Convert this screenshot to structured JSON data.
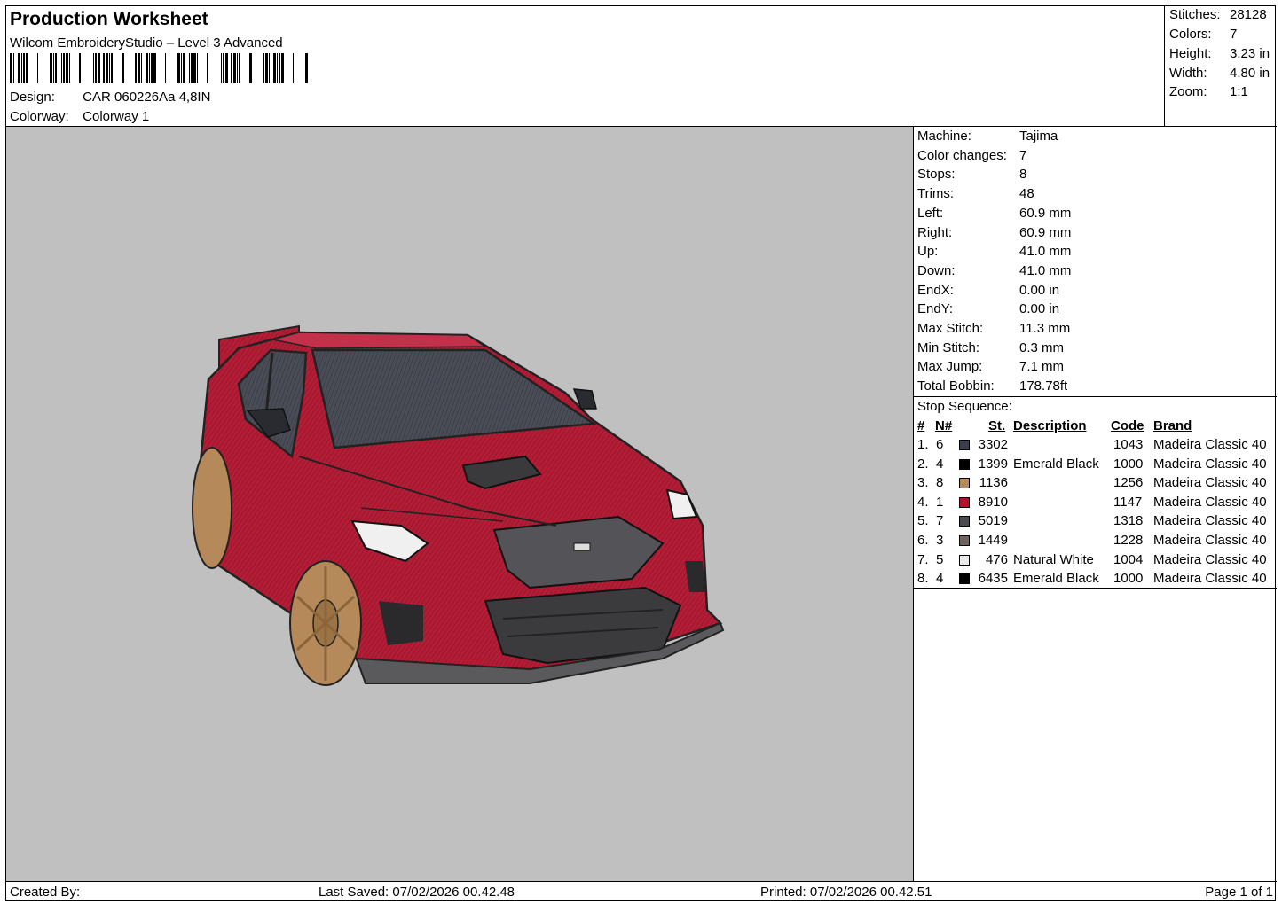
{
  "header": {
    "title": "Production Worksheet",
    "subtitle": "Wilcom EmbroideryStudio – Level 3 Advanced",
    "design_label": "Design:",
    "design_value": "CAR 060226Aa 4,8IN",
    "colorway_label": "Colorway:",
    "colorway_value": "Colorway 1"
  },
  "summary": {
    "stitches_label": "Stitches:",
    "stitches": "28128",
    "colors_label": "Colors:",
    "colors": "7",
    "height_label": "Height:",
    "height": "3.23 in",
    "width_label": "Width:",
    "width": "4.80 in",
    "zoom_label": "Zoom:",
    "zoom": "1:1"
  },
  "machine": {
    "rows": [
      {
        "k": "Machine:",
        "v": "Tajima"
      },
      {
        "k": "Color changes:",
        "v": "7"
      },
      {
        "k": "Stops:",
        "v": "8"
      },
      {
        "k": "Trims:",
        "v": "48"
      },
      {
        "k": "Left:",
        "v": "60.9 mm"
      },
      {
        "k": "Right:",
        "v": "60.9 mm"
      },
      {
        "k": "Up:",
        "v": "41.0 mm"
      },
      {
        "k": "Down:",
        "v": "41.0 mm"
      },
      {
        "k": "EndX:",
        "v": "0.00 in"
      },
      {
        "k": "EndY:",
        "v": "0.00 in"
      },
      {
        "k": "Max Stitch:",
        "v": "11.3 mm"
      },
      {
        "k": "Min Stitch:",
        "v": "0.3 mm"
      },
      {
        "k": "Max Jump:",
        "v": "7.1 mm"
      },
      {
        "k": "Total Bobbin:",
        "v": "178.78ft"
      }
    ]
  },
  "stops": {
    "heading": "Stop Sequence:",
    "col_num": "#",
    "col_n": "N#",
    "col_st": "St.",
    "col_desc": "Description",
    "col_code": "Code",
    "col_brand": "Brand",
    "rows": [
      {
        "num": "1.",
        "n": "6",
        "color": "#3a3d4a",
        "st": "3302",
        "desc": "",
        "code": "1043",
        "brand": "Madeira Classic 40"
      },
      {
        "num": "2.",
        "n": "4",
        "color": "#000000",
        "st": "1399",
        "desc": "Emerald Black",
        "code": "1000",
        "brand": "Madeira Classic 40"
      },
      {
        "num": "3.",
        "n": "8",
        "color": "#b5895a",
        "st": "1136",
        "desc": "",
        "code": "1256",
        "brand": "Madeira Classic 40"
      },
      {
        "num": "4.",
        "n": "1",
        "color": "#b8102c",
        "st": "8910",
        "desc": "",
        "code": "1147",
        "brand": "Madeira Classic 40"
      },
      {
        "num": "5.",
        "n": "7",
        "color": "#4a4a4f",
        "st": "5019",
        "desc": "",
        "code": "1318",
        "brand": "Madeira Classic 40"
      },
      {
        "num": "6.",
        "n": "3",
        "color": "#6e6560",
        "st": "1449",
        "desc": "",
        "code": "1228",
        "brand": "Madeira Classic 40"
      },
      {
        "num": "7.",
        "n": "5",
        "color": "#ebebeb",
        "st": "476",
        "desc": "Natural White",
        "code": "1004",
        "brand": "Madeira Classic 40"
      },
      {
        "num": "8.",
        "n": "4",
        "color": "#000000",
        "st": "6435",
        "desc": "Emerald Black",
        "code": "1000",
        "brand": "Madeira Classic 40"
      }
    ]
  },
  "footer": {
    "created_by": "Created By:",
    "last_saved": "Last Saved: 07/02/2026 00.42.48",
    "printed": "Printed: 07/02/2026 00.42.51",
    "page": "Page 1 of 1"
  }
}
